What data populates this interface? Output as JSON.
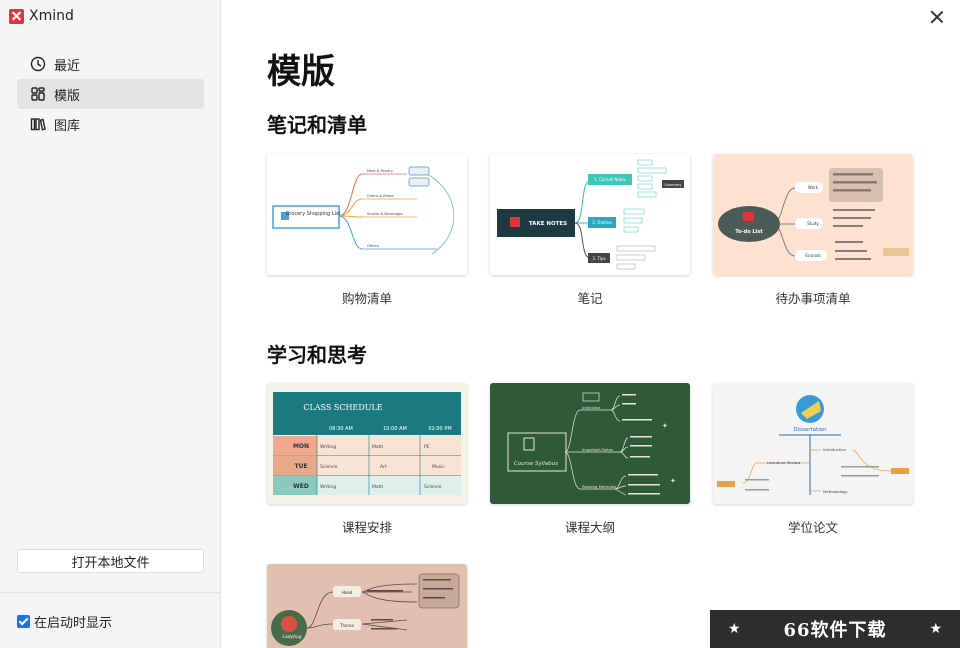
{
  "app": {
    "name": "Xmind"
  },
  "sidebar": {
    "items": [
      {
        "label": "最近",
        "icon": "clock-icon",
        "active": false
      },
      {
        "label": "模版",
        "icon": "grid-icon",
        "active": true
      },
      {
        "label": "图库",
        "icon": "library-icon",
        "active": false
      }
    ],
    "open_local_label": "打开本地文件",
    "show_on_startup_label": "在启动时显示",
    "show_on_startup_checked": true
  },
  "main": {
    "title": "模版",
    "sections": [
      {
        "title": "笔记和清单",
        "templates": [
          {
            "label": "购物清单"
          },
          {
            "label": "笔记"
          },
          {
            "label": "待办事项清单"
          }
        ]
      },
      {
        "title": "学习和思考",
        "templates": [
          {
            "label": "课程安排"
          },
          {
            "label": "课程大纲"
          },
          {
            "label": "学位论文"
          }
        ]
      }
    ]
  },
  "previews": {
    "shopping": {
      "center": "Grocery Shopping List",
      "branches": [
        "Meat & Poultry",
        "Grains & Bread",
        "Snacks & Beverages",
        "Others"
      ]
    },
    "notes": {
      "center": "TAKE NOTES",
      "branches": [
        "1. Cornell Notes",
        "2. Outline",
        "3. Tips"
      ],
      "summary": "Summary"
    },
    "todo": {
      "center": "To-do List",
      "branches": [
        "Work",
        "Study",
        "Errands"
      ]
    },
    "schedule": {
      "title": "CLASS SCHEDULE",
      "times": [
        "08:30 AM",
        "10:00 AM",
        "02:00 PM"
      ],
      "rows": [
        {
          "day": "MON",
          "cells": [
            "Writing",
            "Math",
            "PE"
          ]
        },
        {
          "day": "TUE",
          "cells": [
            "Science",
            "Art",
            "Music"
          ]
        },
        {
          "day": "WED",
          "cells": [
            "Writing",
            "Math",
            "Science"
          ]
        }
      ]
    },
    "syllabus": {
      "center": "Course Syllabus",
      "branches": [
        "Instructor",
        "Important Dates",
        "Reading Materials"
      ]
    },
    "dissertation": {
      "center": "Dissertation",
      "branches": [
        "Literature Review",
        "Introduction",
        "Methodology"
      ]
    },
    "ladybug": {
      "center": "Ladybug",
      "branches": [
        "Head",
        "Thorax"
      ]
    }
  },
  "watermark": {
    "text": "66软件下载"
  },
  "colors": {
    "accent": "#1a73e8",
    "brand": "#e4343a",
    "chalkboard": "#2f5a38",
    "teal": "#1a7a80"
  }
}
